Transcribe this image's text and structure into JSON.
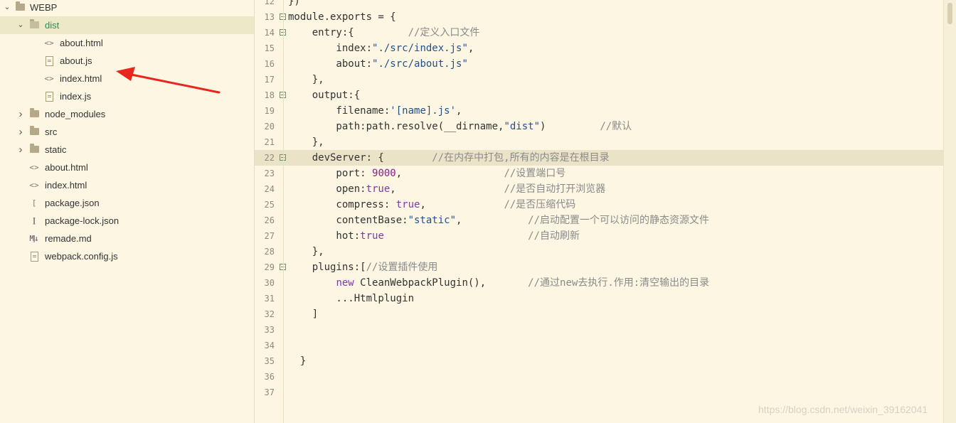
{
  "explorer": {
    "root": {
      "label": "WEBP",
      "icon": "folder-icon"
    },
    "items": [
      {
        "label": "dist",
        "type": "folder-open",
        "level": 1,
        "selected": true,
        "icon": "folder-open-icon"
      },
      {
        "label": "about.html",
        "type": "html",
        "level": 2,
        "icon": "html-file-icon"
      },
      {
        "label": "about.js",
        "type": "js",
        "level": 2,
        "icon": "js-file-icon"
      },
      {
        "label": "index.html",
        "type": "html",
        "level": 2,
        "icon": "html-file-icon"
      },
      {
        "label": "index.js",
        "type": "js",
        "level": 2,
        "icon": "js-file-icon"
      },
      {
        "label": "node_modules",
        "type": "folder",
        "level": 1,
        "icon": "folder-icon"
      },
      {
        "label": "src",
        "type": "folder",
        "level": 1,
        "icon": "folder-icon"
      },
      {
        "label": "static",
        "type": "folder",
        "level": 1,
        "icon": "folder-icon"
      },
      {
        "label": "about.html",
        "type": "html",
        "level": 1,
        "icon": "html-file-icon"
      },
      {
        "label": "index.html",
        "type": "html",
        "level": 1,
        "icon": "html-file-icon"
      },
      {
        "label": "package.json",
        "type": "json",
        "level": 1,
        "icon": "json-file-icon"
      },
      {
        "label": "package-lock.json",
        "type": "json",
        "level": 1,
        "icon": "json-file-icon"
      },
      {
        "label": "remade.md",
        "type": "md",
        "level": 1,
        "icon": "markdown-file-icon"
      },
      {
        "label": "webpack.config.js",
        "type": "js",
        "level": 1,
        "icon": "js-file-icon"
      }
    ]
  },
  "editor": {
    "lines": [
      {
        "num": "12",
        "fold": false,
        "text": "})"
      },
      {
        "num": "13",
        "fold": true,
        "text": "module.exports = {"
      },
      {
        "num": "14",
        "fold": true,
        "text": "    entry:{         //定义入口文件"
      },
      {
        "num": "15",
        "fold": false,
        "text": "        index:\"./src/index.js\","
      },
      {
        "num": "16",
        "fold": false,
        "text": "        about:\"./src/about.js\""
      },
      {
        "num": "17",
        "fold": false,
        "text": "    },"
      },
      {
        "num": "18",
        "fold": true,
        "text": "    output:{"
      },
      {
        "num": "19",
        "fold": false,
        "text": "        filename:'[name].js',"
      },
      {
        "num": "20",
        "fold": false,
        "text": "        path:path.resolve(__dirname,\"dist\")         //默认"
      },
      {
        "num": "21",
        "fold": false,
        "text": "    },"
      },
      {
        "num": "22",
        "fold": true,
        "text": "    devServer: {        //在内存中打包,所有的内容是在根目录",
        "highlight": true
      },
      {
        "num": "23",
        "fold": false,
        "text": "        port: 9000,                 //设置端口号"
      },
      {
        "num": "24",
        "fold": false,
        "text": "        open:true,                  //是否自动打开浏览器"
      },
      {
        "num": "25",
        "fold": false,
        "text": "        compress: true,             //是否压缩代码"
      },
      {
        "num": "26",
        "fold": false,
        "text": "        contentBase:\"static\",           //启动配置一个可以访问的静态资源文件"
      },
      {
        "num": "27",
        "fold": false,
        "text": "        hot:true                        //自动刷新"
      },
      {
        "num": "28",
        "fold": false,
        "text": "    },"
      },
      {
        "num": "29",
        "fold": true,
        "text": "    plugins:[//设置插件使用"
      },
      {
        "num": "30",
        "fold": false,
        "text": "        new CleanWebpackPlugin(),       //通过new去执行.作用:清空输出的目录"
      },
      {
        "num": "31",
        "fold": false,
        "text": "        ...Htmlplugin"
      },
      {
        "num": "32",
        "fold": false,
        "text": "    ]"
      },
      {
        "num": "33",
        "fold": false,
        "text": ""
      },
      {
        "num": "34",
        "fold": false,
        "text": ""
      },
      {
        "num": "35",
        "fold": false,
        "text": "  }"
      },
      {
        "num": "36",
        "fold": false,
        "text": ""
      },
      {
        "num": "37",
        "fold": false,
        "text": ""
      }
    ]
  },
  "watermark": "https://blog.csdn.net/weixin_39162041",
  "annotation": {
    "arrow_color": "#e8261e",
    "points_to": "index.html"
  },
  "colors": {
    "background": "#fdf6e3",
    "selected_folder_text": "#2e8b57",
    "highlight_line": "#ebe3c8"
  }
}
